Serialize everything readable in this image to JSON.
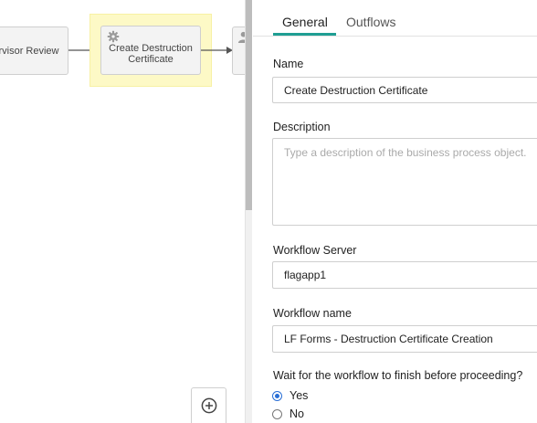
{
  "canvas": {
    "prev_node_label": "rvisor Review",
    "current_node_label": "Create Destruction Certificate"
  },
  "tabs": [
    {
      "label": "General",
      "active": true
    },
    {
      "label": "Outflows",
      "active": false
    }
  ],
  "form": {
    "name_label": "Name",
    "name_value": "Create Destruction Certificate",
    "description_label": "Description",
    "description_placeholder": "Type a description of the business process object.",
    "server_label": "Workflow Server",
    "server_value": "flagapp1",
    "workflow_name_label": "Workflow name",
    "workflow_name_value": "LF Forms - Destruction Certificate Creation",
    "wait_label": "Wait for the workflow to finish before proceeding?",
    "wait_options": [
      {
        "label": "Yes",
        "checked": true
      },
      {
        "label": "No",
        "checked": false
      }
    ]
  },
  "colors": {
    "accent": "#1f9e93",
    "highlight": "#fdf9c6",
    "radio": "#2a6fd6"
  },
  "icons": [
    "gear-icon",
    "person-icon",
    "zoom-in-icon"
  ]
}
